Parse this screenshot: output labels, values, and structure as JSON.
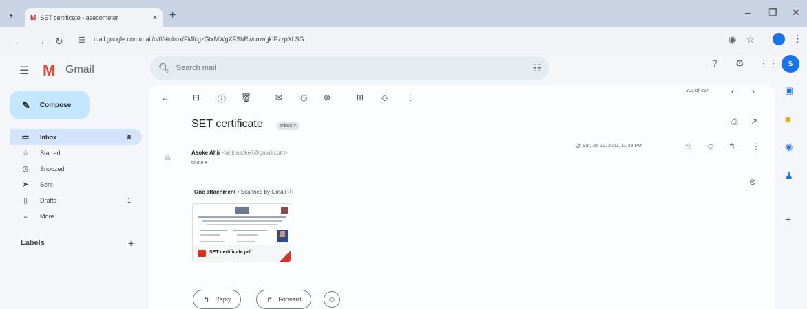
{
  "browser": {
    "tab_title": "SET certificate - asecometer",
    "tab_favicon": "M",
    "tab_close": "×",
    "new_tab": "+",
    "url": "mail.google.com/mail/u/0/#inbox/FMfcgzGtxMWgXFShRwcmwgkfPzzpXLSG"
  },
  "gmail": {
    "product_name": "Gmail",
    "search": {
      "placeholder": "Search mail"
    },
    "avatar_letter": "S",
    "compose_label": "Compose",
    "nav": [
      {
        "label": "Inbox",
        "count": "8",
        "icon": "inbox-icon",
        "active": true
      },
      {
        "label": "Starred",
        "count": "",
        "icon": "star-icon",
        "active": false
      },
      {
        "label": "Snoozed",
        "count": "",
        "icon": "clock-icon",
        "active": false
      },
      {
        "label": "Sent",
        "count": "",
        "icon": "send-icon",
        "active": false
      },
      {
        "label": "Drafts",
        "count": "1",
        "icon": "draft-icon",
        "active": false
      },
      {
        "label": "More",
        "count": "",
        "icon": "chevron-down-icon",
        "active": false
      }
    ],
    "labels_heading": "Labels",
    "pager_text": "203 of 357",
    "message": {
      "subject": "SET certificate",
      "badge": "Inbox ×",
      "sender_name": "Asoke Ahir",
      "sender_email": "<ahir.asoke7@gmail.com>",
      "to": "to me ▾",
      "date": "Sat, Jul 22, 2023, 11:49 PM",
      "attachment_heading": "One attachment",
      "attachment_scanned": "• Scanned by Gmail ⓘ",
      "attachment_name": "SET certificate.pdf"
    },
    "actions": {
      "reply_label": "Reply",
      "forward_label": "Forward"
    }
  }
}
